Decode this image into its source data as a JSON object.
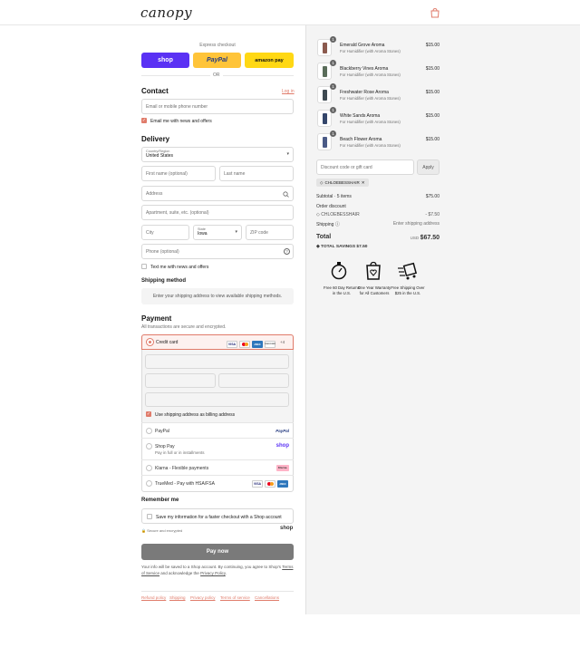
{
  "header": {
    "logo": "canopy"
  },
  "express": {
    "title": "Express checkout",
    "shop_label": "shop",
    "paypal_label": "PayPal",
    "amazon_label": "amazon pay",
    "or_label": "OR"
  },
  "contact": {
    "heading": "Contact",
    "login_label": "Log in",
    "email_placeholder": "Email or mobile phone number",
    "newsletter_label": "Email me with news and offers"
  },
  "delivery": {
    "heading": "Delivery",
    "country_label": "Country/Region",
    "country_value": "United States",
    "first_name": "First name (optional)",
    "last_name": "Last name",
    "address": "Address",
    "apartment": "Apartment, suite, etc. (optional)",
    "city": "City",
    "state_label": "State",
    "state_value": "Iowa",
    "zip": "ZIP code",
    "phone": "Phone (optional)",
    "text_me_label": "Text me with news and offers"
  },
  "shipping_method": {
    "heading": "Shipping method",
    "note": "Enter your shipping address to view available shipping methods."
  },
  "payment": {
    "heading": "Payment",
    "subtitle": "All transactions are secure and encrypted.",
    "credit_card_label": "Credit card",
    "card_more": "+4",
    "billing_label": "Use shipping address as billing address",
    "methods": [
      {
        "label": "PayPal",
        "sub": "",
        "badge": "PayPal"
      },
      {
        "label": "Shop Pay",
        "sub": "Pay in full or in installments",
        "badge": "shop"
      },
      {
        "label": "Klarna - Flexible payments",
        "sub": "",
        "badge": "Klarna."
      },
      {
        "label": "TrueMed - Pay with HSA/FSA",
        "sub": "",
        "badge": ""
      }
    ],
    "card_brands": [
      "VISA",
      "MC",
      "AMEX",
      "DISCOVER"
    ]
  },
  "remember": {
    "heading": "Remember me",
    "save_label": "Save my information for a faster checkout with a Shop account",
    "secure_label": "Secure and encrypted",
    "shop_logo": "shop"
  },
  "pay_button": "Pay now",
  "legal": {
    "text_before": "Your info will be saved to a Shop account. By continuing, you agree to Shop's",
    "terms": "Terms of Service",
    "middle": "and acknowledge the",
    "privacy": "Privacy Policy",
    "end": "."
  },
  "footer_links": [
    "Refund policy",
    "Shipping",
    "Privacy policy",
    "Terms of service",
    "Cancellations"
  ],
  "order": {
    "items": [
      {
        "name": "Emerald Grove Aroma",
        "sub": "For Humidifier (with Aroma Stones)",
        "price": "$15.00",
        "qty": "1",
        "color": "#8b5a4e"
      },
      {
        "name": "Blackberry Vines Aroma",
        "sub": "For Humidifier (with Aroma Stones)",
        "price": "$15.00",
        "qty": "1",
        "color": "#5a6d5a"
      },
      {
        "name": "Freshwater Rose Aroma",
        "sub": "For Humidifier (with Aroma Stones)",
        "price": "$15.00",
        "qty": "1",
        "color": "#3f4a52"
      },
      {
        "name": "White Sands Aroma",
        "sub": "For Humidifier (with Aroma Stones)",
        "price": "$15.00",
        "qty": "1",
        "color": "#34466b"
      },
      {
        "name": "Beach Flower Aroma",
        "sub": "For Humidifier (with Aroma Stones)",
        "price": "$15.00",
        "qty": "1",
        "color": "#4a5a86"
      }
    ],
    "discount_placeholder": "Discount code or gift card",
    "apply_label": "Apply",
    "code_tag": "CHLOEBESSHAIR",
    "subtotal_label": "Subtotal · 5 items",
    "subtotal_value": "$75.00",
    "order_discount_label": "Order discount",
    "discount_code": "CHLOEBESSHAIR",
    "discount_value": "- $7.50",
    "shipping_label": "Shipping",
    "shipping_value": "Enter shipping address",
    "total_label": "Total",
    "currency": "USD",
    "total_value": "$67.50",
    "savings_label": "TOTAL SAVINGS",
    "savings_value": "$7.50"
  },
  "perks": [
    {
      "text": "Free 60 Day Returns in the U.S."
    },
    {
      "text": "One Year Warranty for All Customers"
    },
    {
      "text": "Free Shipping Over $25 in the U.S."
    }
  ],
  "colors": {
    "accent": "#e07b6a",
    "shop": "#5a31f4",
    "paypal": "#ffc439",
    "amazon": "#ffd814",
    "pay_button": "#7a7a7a"
  }
}
